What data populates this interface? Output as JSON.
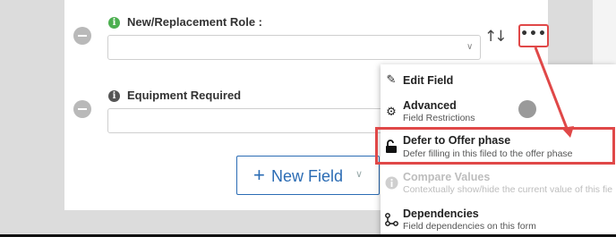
{
  "form": {
    "fields": [
      {
        "label": "New/Replacement Role :",
        "value": "",
        "info_color": "#4caf50"
      },
      {
        "label": "Equipment Required",
        "value": "",
        "info_color": "#555555"
      }
    ],
    "sort_icon": "sort-arrows-icon",
    "more_label": "•••",
    "new_field": {
      "plus": "+",
      "label": "New Field"
    }
  },
  "menu": {
    "items": [
      {
        "icon": "pencil-icon",
        "title": "Edit Field",
        "subtitle": ""
      },
      {
        "icon": "gear-icon",
        "title": "Advanced",
        "subtitle": "Field Restrictions"
      },
      {
        "icon": "lock-open-icon",
        "title": "Defer to Offer phase",
        "subtitle": "Defer filling in this filed to the offer phase"
      },
      {
        "icon": "info-icon",
        "title": "Compare Values",
        "subtitle": "Contextually show/hide the current value of this fie",
        "disabled": true
      },
      {
        "icon": "dependencies-icon",
        "title": "Dependencies",
        "subtitle": "Field dependencies on this form"
      }
    ]
  },
  "annotation_color": "#e04848",
  "accent_color": "#2b6cb4"
}
